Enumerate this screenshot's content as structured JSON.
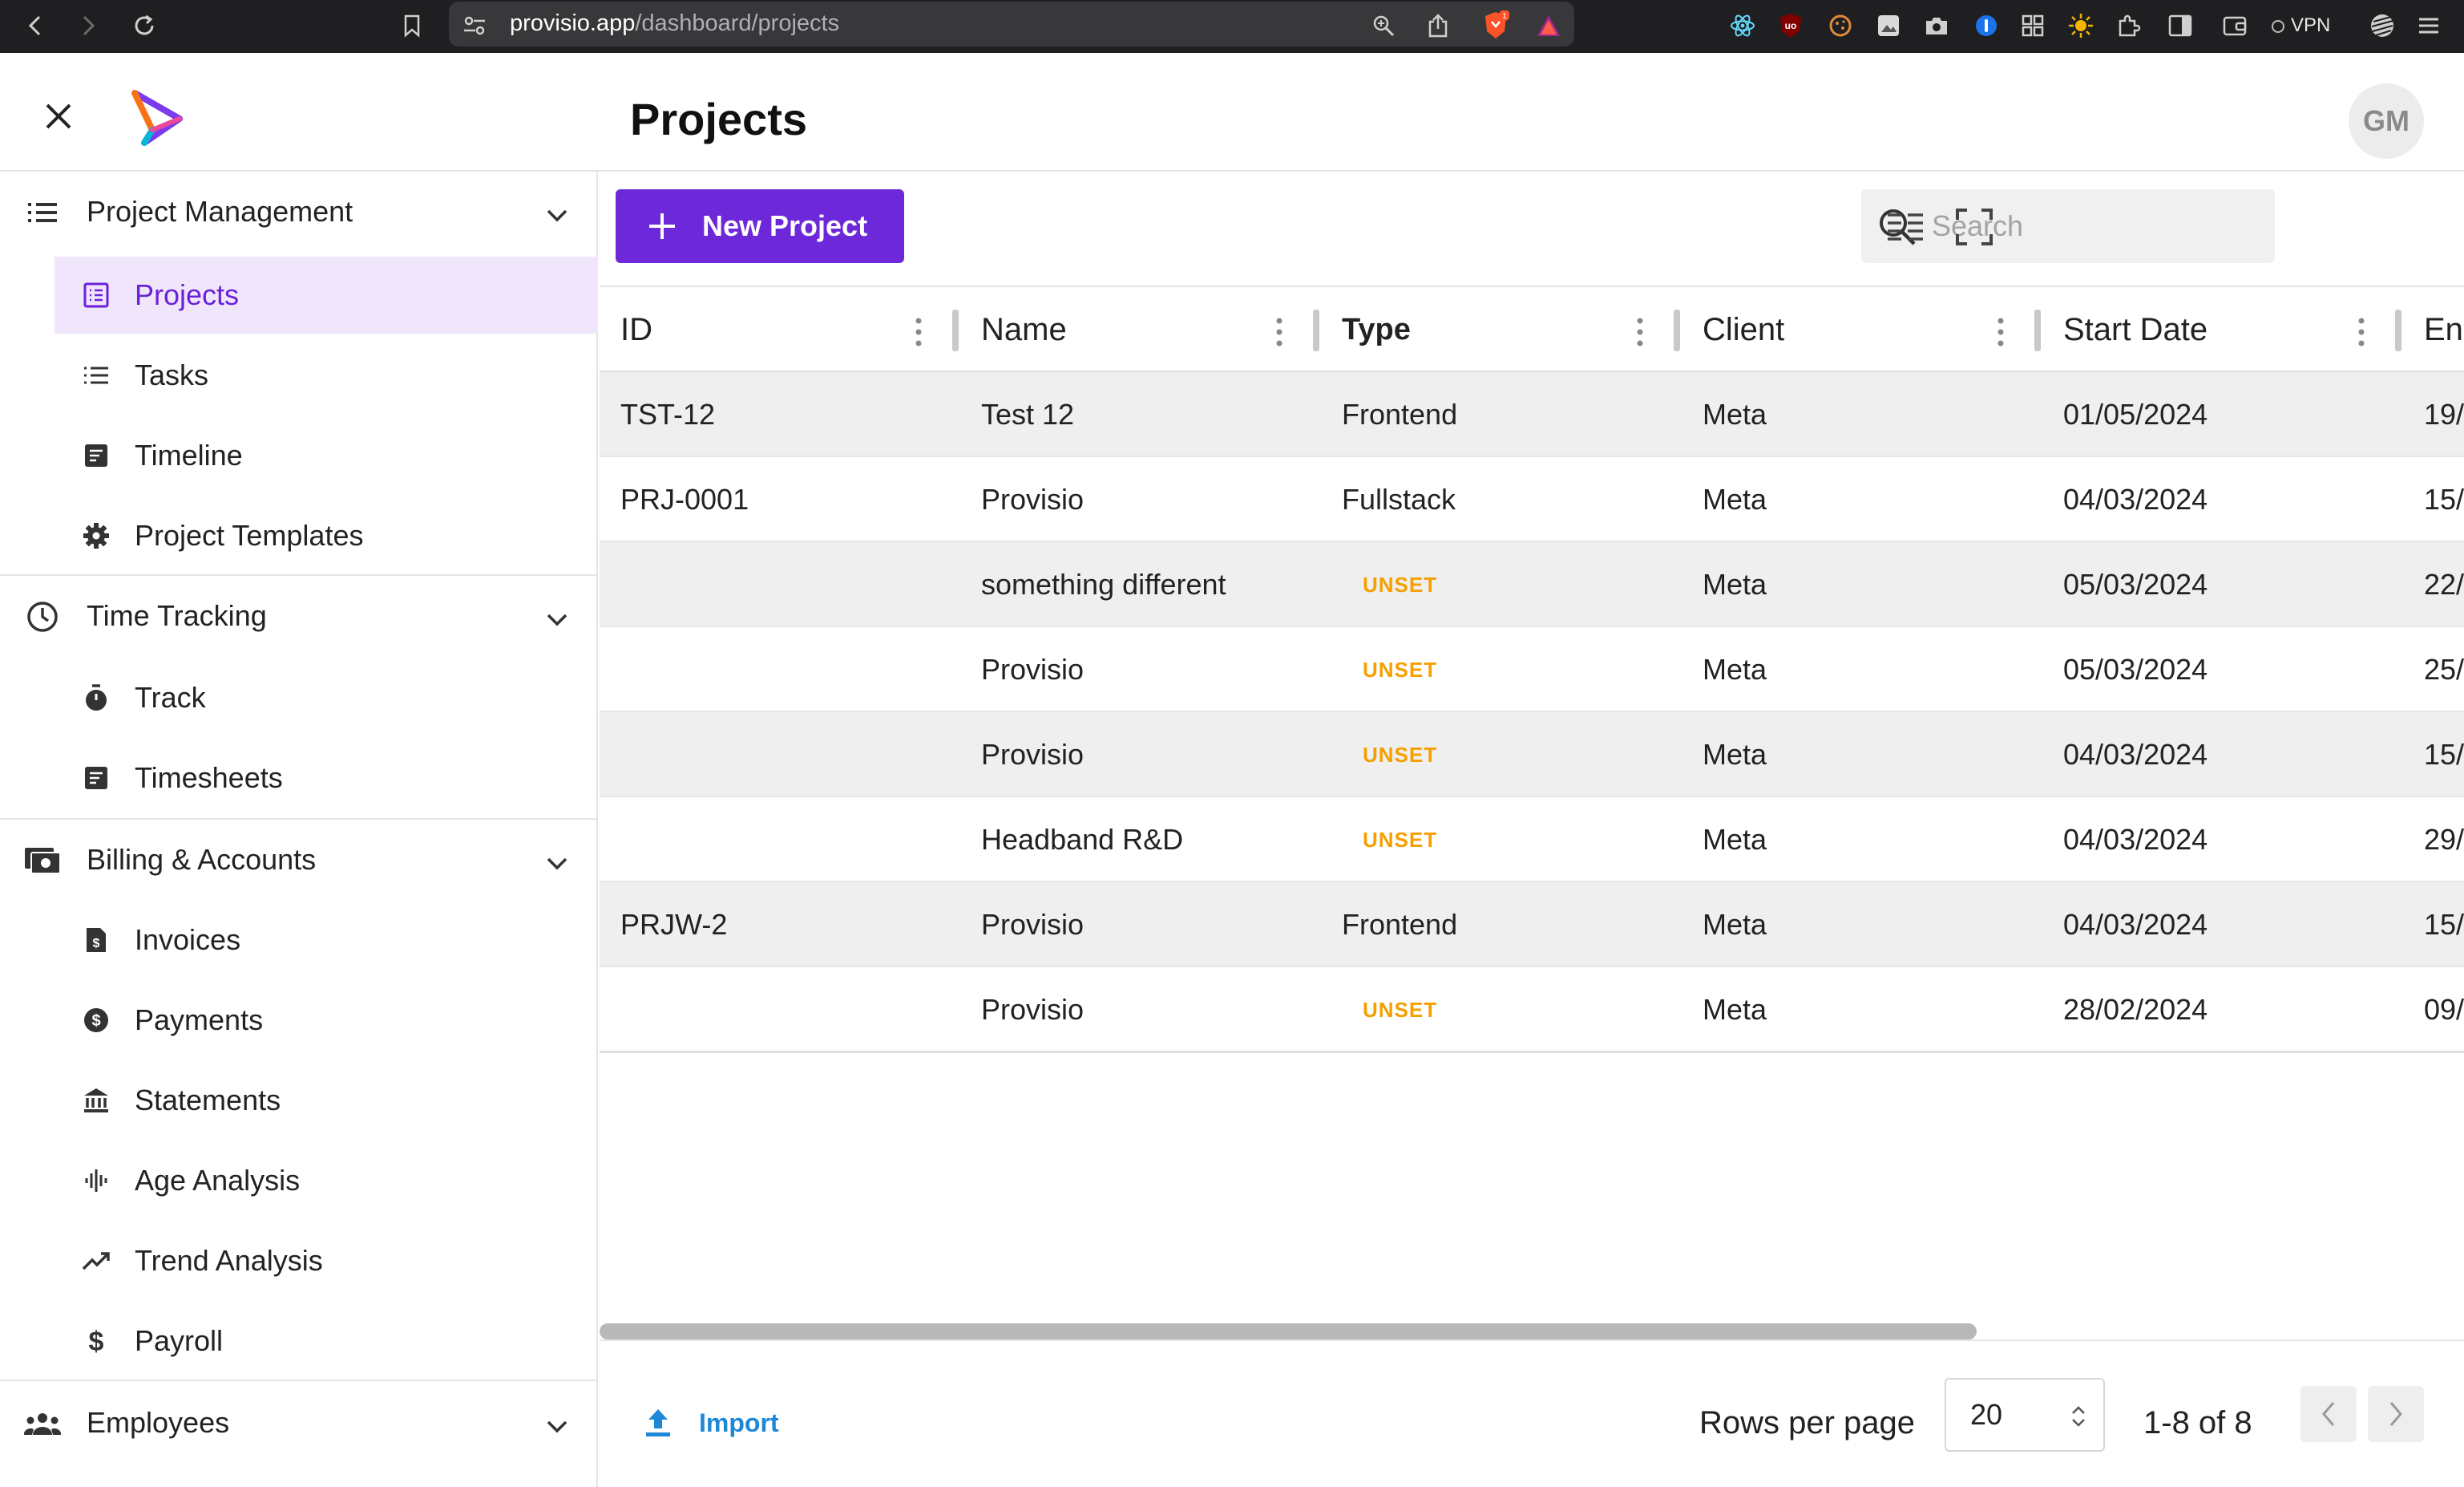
{
  "browser": {
    "url_host": "provisio.app",
    "url_path": "/dashboard/projects",
    "vpn_label": "VPN",
    "extension_badge": "1"
  },
  "header": {
    "title": "Projects",
    "avatar_initials": "GM"
  },
  "sidebar": {
    "sections": [
      {
        "label": "Project Management",
        "icon": "list-icon",
        "items": [
          {
            "label": "Projects",
            "icon": "projects-icon",
            "active": true
          },
          {
            "label": "Tasks",
            "icon": "tasks-list-icon"
          },
          {
            "label": "Timeline",
            "icon": "timeline-icon"
          },
          {
            "label": "Project Templates",
            "icon": "gear-icon"
          }
        ]
      },
      {
        "label": "Time Tracking",
        "icon": "clock-icon",
        "items": [
          {
            "label": "Track",
            "icon": "stopwatch-icon"
          },
          {
            "label": "Timesheets",
            "icon": "timesheets-icon"
          }
        ]
      },
      {
        "label": "Billing & Accounts",
        "icon": "money-icon",
        "items": [
          {
            "label": "Invoices",
            "icon": "invoice-icon"
          },
          {
            "label": "Payments",
            "icon": "dollar-circle-icon"
          },
          {
            "label": "Statements",
            "icon": "bank-icon"
          },
          {
            "label": "Age Analysis",
            "icon": "waveform-icon"
          },
          {
            "label": "Trend Analysis",
            "icon": "trend-icon"
          },
          {
            "label": "Payroll",
            "icon": "dollar-icon"
          }
        ]
      },
      {
        "label": "Employees",
        "icon": "people-icon",
        "items": []
      }
    ]
  },
  "toolbar": {
    "new_project_label": "New Project",
    "search_placeholder": "Search"
  },
  "table": {
    "columns": [
      "ID",
      "Name",
      "Type",
      "Client",
      "Start Date",
      "End"
    ],
    "rows": [
      {
        "id": "TST-12",
        "name": "Test 12",
        "type": "Frontend",
        "client": "Meta",
        "start": "01/05/2024",
        "end": "19/"
      },
      {
        "id": "PRJ-0001",
        "name": "Provisio",
        "type": "Fullstack",
        "client": "Meta",
        "start": "04/03/2024",
        "end": "15/"
      },
      {
        "id": "",
        "name": "something different",
        "type": "UNSET",
        "client": "Meta",
        "start": "05/03/2024",
        "end": "22/"
      },
      {
        "id": "",
        "name": "Provisio",
        "type": "UNSET",
        "client": "Meta",
        "start": "05/03/2024",
        "end": "25/"
      },
      {
        "id": "",
        "name": "Provisio",
        "type": "UNSET",
        "client": "Meta",
        "start": "04/03/2024",
        "end": "15/"
      },
      {
        "id": "",
        "name": "Headband R&D",
        "type": "UNSET",
        "client": "Meta",
        "start": "04/03/2024",
        "end": "29/"
      },
      {
        "id": "PRJW-2",
        "name": "Provisio",
        "type": "Frontend",
        "client": "Meta",
        "start": "04/03/2024",
        "end": "15/"
      },
      {
        "id": "",
        "name": "Provisio",
        "type": "UNSET",
        "client": "Meta",
        "start": "28/02/2024",
        "end": "09/"
      }
    ]
  },
  "footer": {
    "import_label": "Import",
    "rows_per_page_label": "Rows per page",
    "rows_per_page_value": "20",
    "range_label": "1-8 of 8"
  },
  "colors": {
    "accent": "#6d28d9",
    "active_bg": "#f0e6fc",
    "unset": "#f5a000",
    "link": "#1e88d8"
  }
}
